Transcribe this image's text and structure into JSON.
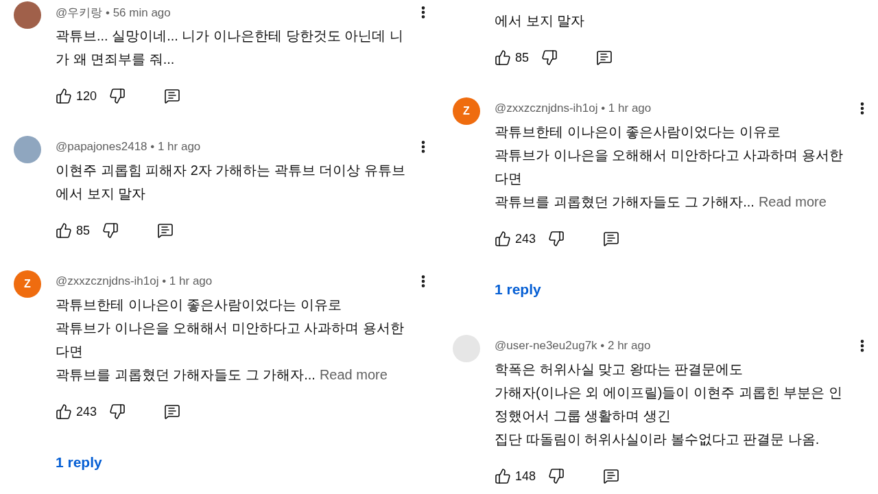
{
  "columns": [
    {
      "comments": [
        {
          "avatar": {
            "kind": "image",
            "color": "#a0604a"
          },
          "byline": "@우키랑 • 56 min ago",
          "body": [
            "곽튜브... 실망이네... 니가 이나은한테 당한것도 아닌데 니",
            "가 왜 면죄부를 줘..."
          ],
          "likes": "120"
        },
        {
          "avatar": {
            "kind": "image",
            "color": "#8fa6bf"
          },
          "byline": "@papajones2418 • 1 hr ago",
          "body": [
            "이현주 괴롭힘 피해자 2자 가해하는 곽튜브 더이상 유튜브",
            "에서 보지 말자"
          ],
          "likes": "85"
        },
        {
          "avatar": {
            "kind": "letter",
            "letter": "Z",
            "color": "#ef6c0f"
          },
          "byline": "@zxxzcznjdns-ih1oj • 1 hr ago",
          "body": [
            "곽튜브한테 이나은이 좋은사람이었다는 이유로",
            "곽튜브가 이나은을 오해해서 미안하다고 사과하며 용서한",
            "다면",
            "곽튜브를 괴롭혔던 가해자들도 그 가해자..."
          ],
          "read_more": "Read more",
          "likes": "243",
          "replies": "1 reply"
        }
      ]
    },
    {
      "comments": [
        {
          "body": [
            "에서 보지 말자"
          ],
          "likes": "85"
        },
        {
          "avatar": {
            "kind": "letter",
            "letter": "Z",
            "color": "#ef6c0f"
          },
          "byline": "@zxxzcznjdns-ih1oj • 1 hr ago",
          "body": [
            "곽튜브한테 이나은이 좋은사람이었다는 이유로",
            "곽튜브가 이나은을 오해해서 미안하다고 사과하며 용서한",
            "다면",
            "곽튜브를 괴롭혔던 가해자들도 그 가해자..."
          ],
          "read_more": "Read more",
          "likes": "243",
          "replies": "1 reply"
        },
        {
          "avatar": {
            "kind": "image",
            "color": "#e6e6e6"
          },
          "byline": "@user-ne3eu2ug7k • 2 hr ago",
          "body": [
            "학폭은 허위사실 맞고 왕따는 판결문에도",
            "가해자(이나은 외 에이프릴)들이 이현주 괴롭힌 부분은 인",
            "정했어서 그룹 생활하며 생긴",
            "집단 따돌림이 허위사실이라 볼수없다고 판결문 나옴."
          ],
          "likes": "148"
        }
      ]
    }
  ]
}
